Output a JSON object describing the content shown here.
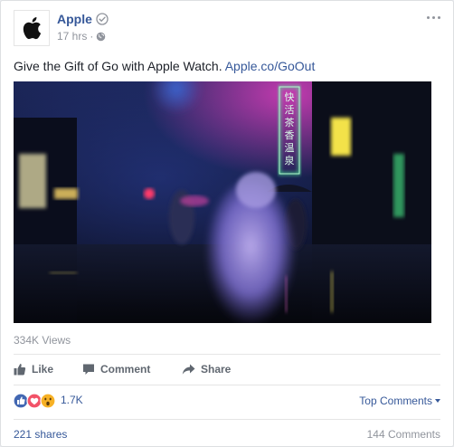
{
  "post": {
    "page_name": "Apple",
    "timestamp": "17 hrs",
    "meta_separator": "·",
    "text": "Give the Gift of Go with Apple Watch.",
    "link_text": "Apple.co/GoOut"
  },
  "video": {
    "sign_chars": [
      "快",
      "活",
      "茶",
      "香",
      "温",
      "泉"
    ]
  },
  "stats": {
    "views": "334K Views",
    "reaction_count": "1.7K",
    "top_comments_label": "Top Comments",
    "shares": "221 shares",
    "comments": "144 Comments"
  },
  "actions": {
    "like": "Like",
    "comment": "Comment",
    "share": "Share"
  },
  "colors": {
    "link_blue": "#365899",
    "like_blue": "#4267b2",
    "love_red": "#f25268",
    "wow_yellow": "#f7b125",
    "muted_gray": "#90949c"
  }
}
